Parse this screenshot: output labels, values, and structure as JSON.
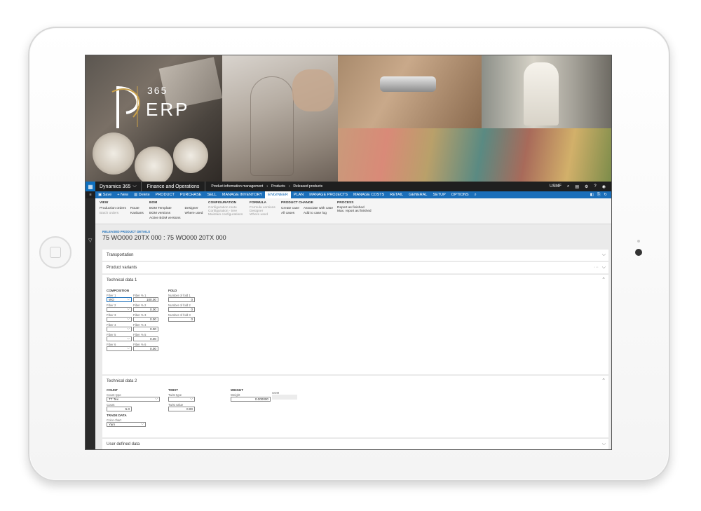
{
  "logo": {
    "number": "365",
    "text": "ERP"
  },
  "topnav": {
    "brand": "Dynamics 365",
    "brand_chevron": "⌵",
    "app": "Finance and Operations",
    "breadcrumb": [
      "Product information management",
      "Products",
      "Released products"
    ],
    "company": "USMF"
  },
  "ribbon": {
    "items": [
      {
        "label": "Save",
        "icon": "save-icon"
      },
      {
        "label": "+ New",
        "icon": "new-icon"
      },
      {
        "label": "Delete",
        "icon": "delete-icon"
      },
      {
        "label": "PRODUCT"
      },
      {
        "label": "PURCHASE"
      },
      {
        "label": "SELL"
      },
      {
        "label": "MANAGE INVENTORY"
      },
      {
        "label": "ENGINEER",
        "active": true
      },
      {
        "label": "PLAN"
      },
      {
        "label": "MANAGE PROJECTS"
      },
      {
        "label": "MANAGE COSTS"
      },
      {
        "label": "RETAIL"
      },
      {
        "label": "GENERAL"
      },
      {
        "label": "SETUP"
      },
      {
        "label": "OPTIONS"
      }
    ]
  },
  "actionpane": {
    "view": {
      "title": "VIEW",
      "col1": [
        "Production orders",
        "Batch orders"
      ],
      "col2": [
        "Route",
        "Kanbans"
      ]
    },
    "bom": {
      "title": "BOM",
      "col1": [
        "BOM Template",
        "BOM versions",
        "Active BOM versions"
      ],
      "col2": [
        "Designer",
        "Where used"
      ]
    },
    "configuration": {
      "title": "CONFIGURATION",
      "col1": [
        "Configuration route",
        "Configuration - tree",
        "Maintain configurations"
      ]
    },
    "formula": {
      "title": "FORMULA",
      "col1": [
        "Formula versions",
        "Designer",
        "Where used"
      ]
    },
    "product_change": {
      "title": "PRODUCT CHANGE",
      "col1": [
        "Create case",
        "All cases"
      ],
      "col2": [
        "Associate with case",
        "Add to case log"
      ]
    },
    "process": {
      "title": "PROCESS",
      "col1": [
        "Report as finished",
        "Max. report as finished"
      ]
    }
  },
  "header": {
    "caption": "RELEASED PRODUCT DETAILS",
    "title": "75 WO000 20TX 000 : 75 WO000 20TX 000"
  },
  "fasttabs": {
    "transportation": "Transportation",
    "variants": "Product variants",
    "variants_more": "···",
    "tech1": "Technical data 1",
    "tech2": "Technical data 2",
    "userdef": "User defined data"
  },
  "tech1": {
    "composition_title": "COMPOSITION",
    "fold_title": "FOLD",
    "fibers": [
      {
        "label": "Fiber 1",
        "value": "WO",
        "pct_label": "Fiber % 1",
        "pct": "100.00"
      },
      {
        "label": "Fiber 2",
        "value": "",
        "pct_label": "Fiber % 2",
        "pct": "0.00"
      },
      {
        "label": "Fiber 3",
        "value": "",
        "pct_label": "Fiber % 3",
        "pct": "0.00"
      },
      {
        "label": "Fiber 4",
        "value": "",
        "pct_label": "Fiber % 4",
        "pct": "0.00"
      },
      {
        "label": "Fiber 5",
        "value": "",
        "pct_label": "Fiber % 5",
        "pct": "0.00"
      },
      {
        "label": "Fiber 6",
        "value": "",
        "pct_label": "Fiber % 6",
        "pct": "0.00"
      }
    ],
    "folds": [
      {
        "label": "Number of fold 1",
        "value": "0"
      },
      {
        "label": "Number of fold 2",
        "value": "0"
      },
      {
        "label": "Number of fold 3",
        "value": "0"
      }
    ]
  },
  "tech2": {
    "count_title": "COUNT",
    "count_type_label": "Count type",
    "count_type": "TT Tex",
    "count_label": "Count",
    "count": "5.0",
    "twist_title": "TWIST",
    "twist_type_label": "Twist type",
    "twist_type": "",
    "twist_value_label": "Twist value",
    "twist_value": "0.00",
    "weight_title": "WEIGHT",
    "weight_label": "Weight",
    "weight": "0.000000",
    "uom_label": "UOM",
    "uom": "",
    "trade_title": "TRADE DATA",
    "color_chart_label": "Color chart",
    "color_chart": "Yarn"
  },
  "colors": {
    "accent": "#1b6fba",
    "navbar": "#1f1f1f"
  }
}
